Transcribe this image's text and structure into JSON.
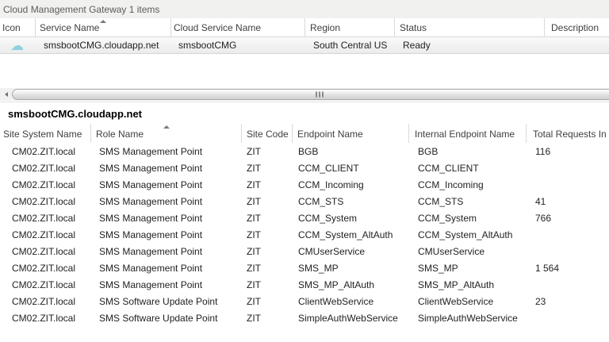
{
  "top_list": {
    "title": "Cloud Management Gateway 1 items",
    "columns": [
      {
        "label": "Icon"
      },
      {
        "label": "Service Name",
        "sorted": "asc"
      },
      {
        "label": "Cloud Service Name"
      },
      {
        "label": "Region"
      },
      {
        "label": "Status"
      },
      {
        "label": "Description"
      }
    ],
    "row": {
      "icon": "cloud-icon",
      "service_name": "smsbootCMG.cloudapp.net",
      "cloud_service_name": "smsbootCMG",
      "region": "South Central US",
      "status": "Ready",
      "description": ""
    }
  },
  "scrollbar": {
    "orientation": "horizontal",
    "grip_icon": "splitter-grip-icon",
    "left_arrow_icon": "scroll-left-arrow-icon"
  },
  "detail_pane": {
    "title": "smsbootCMG.cloudapp.net",
    "columns": [
      {
        "label": "Site System Name"
      },
      {
        "label": "Role Name",
        "sorted": "asc"
      },
      {
        "label": "Site Code"
      },
      {
        "label": "Endpoint Name"
      },
      {
        "label": "Internal Endpoint Name"
      },
      {
        "label": "Total Requests In L"
      }
    ],
    "rows": [
      [
        "CM02.ZIT.local",
        "SMS Management Point",
        "ZIT",
        "BGB",
        "BGB",
        "116"
      ],
      [
        "CM02.ZIT.local",
        "SMS Management Point",
        "ZIT",
        "CCM_CLIENT",
        "CCM_CLIENT",
        ""
      ],
      [
        "CM02.ZIT.local",
        "SMS Management Point",
        "ZIT",
        "CCM_Incoming",
        "CCM_Incoming",
        ""
      ],
      [
        "CM02.ZIT.local",
        "SMS Management Point",
        "ZIT",
        "CCM_STS",
        "CCM_STS",
        "41"
      ],
      [
        "CM02.ZIT.local",
        "SMS Management Point",
        "ZIT",
        "CCM_System",
        "CCM_System",
        "766"
      ],
      [
        "CM02.ZIT.local",
        "SMS Management Point",
        "ZIT",
        "CCM_System_AltAuth",
        "CCM_System_AltAuth",
        ""
      ],
      [
        "CM02.ZIT.local",
        "SMS Management Point",
        "ZIT",
        "CMUserService",
        "CMUserService",
        ""
      ],
      [
        "CM02.ZIT.local",
        "SMS Management Point",
        "ZIT",
        "SMS_MP",
        "SMS_MP",
        "1 564"
      ],
      [
        "CM02.ZIT.local",
        "SMS Management Point",
        "ZIT",
        "SMS_MP_AltAuth",
        "SMS_MP_AltAuth",
        ""
      ],
      [
        "CM02.ZIT.local",
        "SMS Software Update Point",
        "ZIT",
        "ClientWebService",
        "ClientWebService",
        "23"
      ],
      [
        "CM02.ZIT.local",
        "SMS Software Update Point",
        "ZIT",
        "SimpleAuthWebService",
        "SimpleAuthWebService",
        ""
      ]
    ]
  },
  "colors": {
    "cloud_icon": "#8ed0e0",
    "caption_bg": "#f1f1f0",
    "selected_row_border": "#d6d6d6"
  }
}
